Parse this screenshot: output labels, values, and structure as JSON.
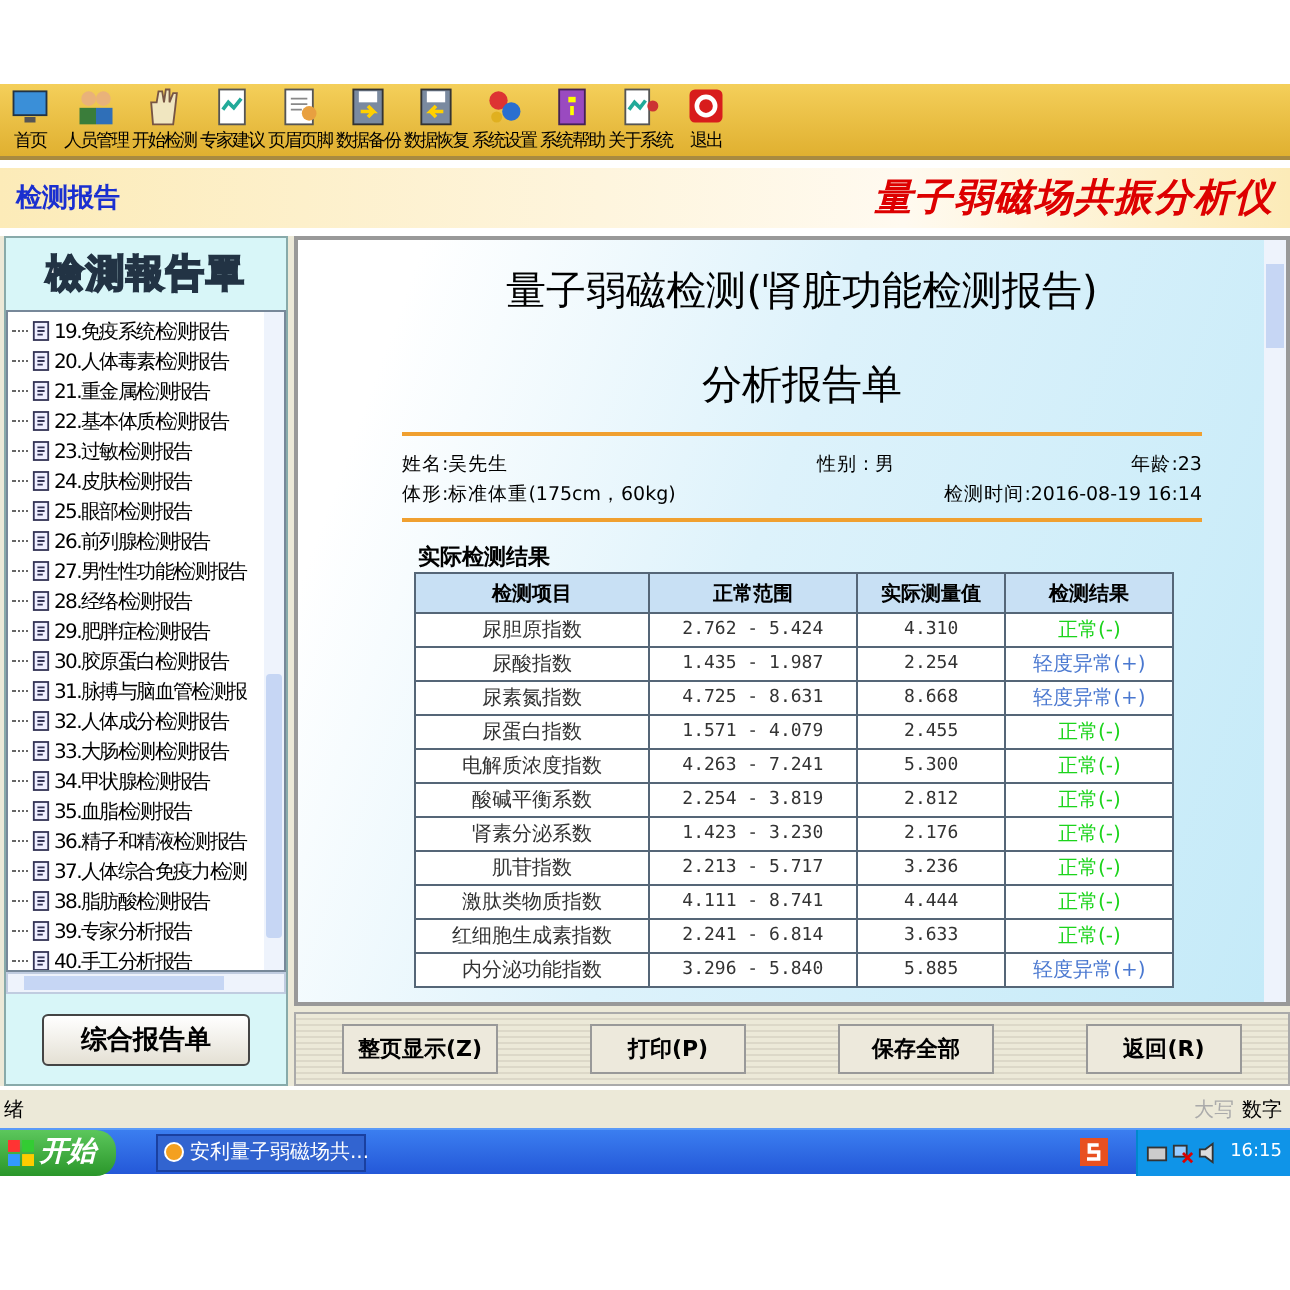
{
  "toolbar": [
    {
      "label": "首页"
    },
    {
      "label": "人员管理"
    },
    {
      "label": "开始检测"
    },
    {
      "label": "专家建议"
    },
    {
      "label": "页眉页脚"
    },
    {
      "label": "数据备份"
    },
    {
      "label": "数据恢复"
    },
    {
      "label": "系统设置"
    },
    {
      "label": "系统帮助"
    },
    {
      "label": "关于系统"
    },
    {
      "label": "退出"
    }
  ],
  "header": {
    "section_title": "检测报告",
    "app_title": "量子弱磁场共振分析仪"
  },
  "sidebar": {
    "title": "檢測報告單",
    "items": [
      {
        "label": "19.免疫系统检测报告"
      },
      {
        "label": "20.人体毒素检测报告"
      },
      {
        "label": "21.重金属检测报告"
      },
      {
        "label": "22.基本体质检测报告"
      },
      {
        "label": "23.过敏检测报告"
      },
      {
        "label": "24.皮肤检测报告"
      },
      {
        "label": "25.眼部检测报告"
      },
      {
        "label": "26.前列腺检测报告"
      },
      {
        "label": "27.男性性功能检测报告"
      },
      {
        "label": "28.经络检测报告"
      },
      {
        "label": "29.肥胖症检测报告"
      },
      {
        "label": "30.胶原蛋白检测报告"
      },
      {
        "label": "31.脉搏与脑血管检测报"
      },
      {
        "label": "32.人体成分检测报告"
      },
      {
        "label": "33.大肠检测检测报告"
      },
      {
        "label": "34.甲状腺检测报告"
      },
      {
        "label": "35.血脂检测报告"
      },
      {
        "label": "36.精子和精液检测报告"
      },
      {
        "label": "37.人体综合免疫力检测"
      },
      {
        "label": "38.脂肪酸检测报告"
      },
      {
        "label": "39.专家分析报告"
      },
      {
        "label": "40.手工分析报告"
      }
    ],
    "button": "综合报告单"
  },
  "report": {
    "title": "量子弱磁检测(肾脏功能检测报告)",
    "subtitle": "分析报告单",
    "name": "姓名:吴先生",
    "gender": "性别 : 男",
    "age": "年龄:23",
    "body_shape": "体形:标准体重(175cm，60kg)",
    "test_time": "检测时间:2016-08-19 16:14",
    "section": "实际检测结果",
    "columns": [
      "检测项目",
      "正常范围",
      "实际测量值",
      "检测结果"
    ],
    "rows": [
      {
        "item": "尿胆原指数",
        "range": "2.762 - 5.424",
        "value": "4.310",
        "result": "正常(-)",
        "kind": "normal"
      },
      {
        "item": "尿酸指数",
        "range": "1.435 - 1.987",
        "value": "2.254",
        "result": "轻度异常(+)",
        "kind": "mild"
      },
      {
        "item": "尿素氮指数",
        "range": "4.725 - 8.631",
        "value": "8.668",
        "result": "轻度异常(+)",
        "kind": "mild"
      },
      {
        "item": "尿蛋白指数",
        "range": "1.571 - 4.079",
        "value": "2.455",
        "result": "正常(-)",
        "kind": "normal"
      },
      {
        "item": "电解质浓度指数",
        "range": "4.263 - 7.241",
        "value": "5.300",
        "result": "正常(-)",
        "kind": "normal"
      },
      {
        "item": "酸碱平衡系数",
        "range": "2.254 - 3.819",
        "value": "2.812",
        "result": "正常(-)",
        "kind": "normal"
      },
      {
        "item": "肾素分泌系数",
        "range": "1.423 - 3.230",
        "value": "2.176",
        "result": "正常(-)",
        "kind": "normal"
      },
      {
        "item": "肌苷指数",
        "range": "2.213 - 5.717",
        "value": "3.236",
        "result": "正常(-)",
        "kind": "normal"
      },
      {
        "item": "激肽类物质指数",
        "range": "4.111 - 8.741",
        "value": "4.444",
        "result": "正常(-)",
        "kind": "normal"
      },
      {
        "item": "红细胞生成素指数",
        "range": "2.241 - 6.814",
        "value": "3.633",
        "result": "正常(-)",
        "kind": "normal"
      },
      {
        "item": "内分泌功能指数",
        "range": "3.296 - 5.840",
        "value": "5.885",
        "result": "轻度异常(+)",
        "kind": "mild"
      }
    ]
  },
  "buttons": [
    "整页显示(Z)",
    "打印(P)",
    "保存全部",
    "返回(R)"
  ],
  "status_bar": {
    "message": "绪",
    "indicators": [
      {
        "label": "大写",
        "on": false
      },
      {
        "label": "数字",
        "on": true
      }
    ]
  },
  "taskbar": {
    "start": "开始",
    "task": "安利量子弱磁场共...",
    "clock": "16:15"
  }
}
